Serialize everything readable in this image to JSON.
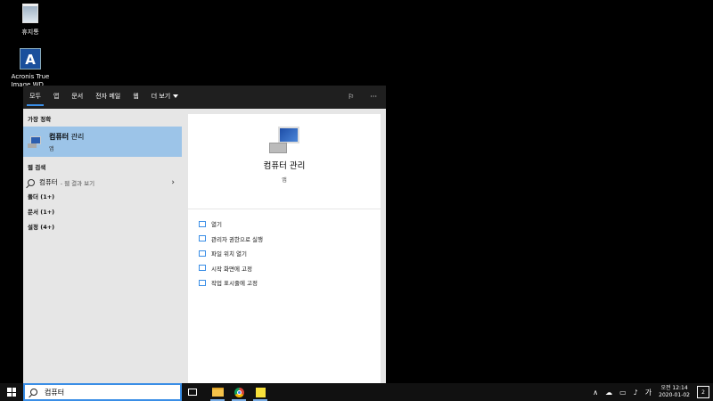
{
  "desktop": {
    "icons": [
      {
        "label": "휴지통"
      },
      {
        "label": "Acronis True Image WD..."
      }
    ]
  },
  "start_menu": {
    "tabs": [
      {
        "label": "모두",
        "active": true
      },
      {
        "label": "앱"
      },
      {
        "label": "문서"
      },
      {
        "label": "전자 메일"
      },
      {
        "label": "웹"
      },
      {
        "label": "더 보기"
      }
    ],
    "right_icons": {
      "feedback": "feedback-icon",
      "more": "···"
    },
    "results": {
      "best_match_header": "가장 정확",
      "best_match": {
        "title_bold": "컴퓨터",
        "title_rest": " 관리",
        "subtitle": "앱"
      },
      "web_header": "웹 검색",
      "web_item": {
        "query": "컴퓨터",
        "hint": "- 웹 결과 보기",
        "chevron": "›"
      },
      "categories": [
        "폴더 (1+)",
        "문서 (1+)",
        "설정 (4+)"
      ]
    },
    "preview": {
      "title": "컴퓨터 관리",
      "subtitle": "앱",
      "actions": [
        {
          "label": "열기",
          "icon": "open-icon"
        },
        {
          "label": "관리자 권한으로 실행",
          "icon": "run-as-admin-icon"
        },
        {
          "label": "파일 위치 열기",
          "icon": "file-location-icon"
        },
        {
          "label": "시작 화면에 고정",
          "icon": "pin-start-icon"
        },
        {
          "label": "작업 표시줄에 고정",
          "icon": "pin-taskbar-icon"
        }
      ]
    }
  },
  "taskbar": {
    "search_value": "컴퓨터",
    "tray": {
      "chevron": "∧",
      "cloud": "☁",
      "battery": "▭",
      "volume": "♪",
      "ime": "가"
    },
    "clock": {
      "time": "오전 12:14",
      "date": "2020-01-02"
    },
    "notification_count": "2"
  },
  "colors": {
    "accent": "#3a8ee6",
    "selection": "#9cc4e8",
    "menu_bg": "#1f1f1f",
    "panel_bg": "#e6e6e6"
  }
}
